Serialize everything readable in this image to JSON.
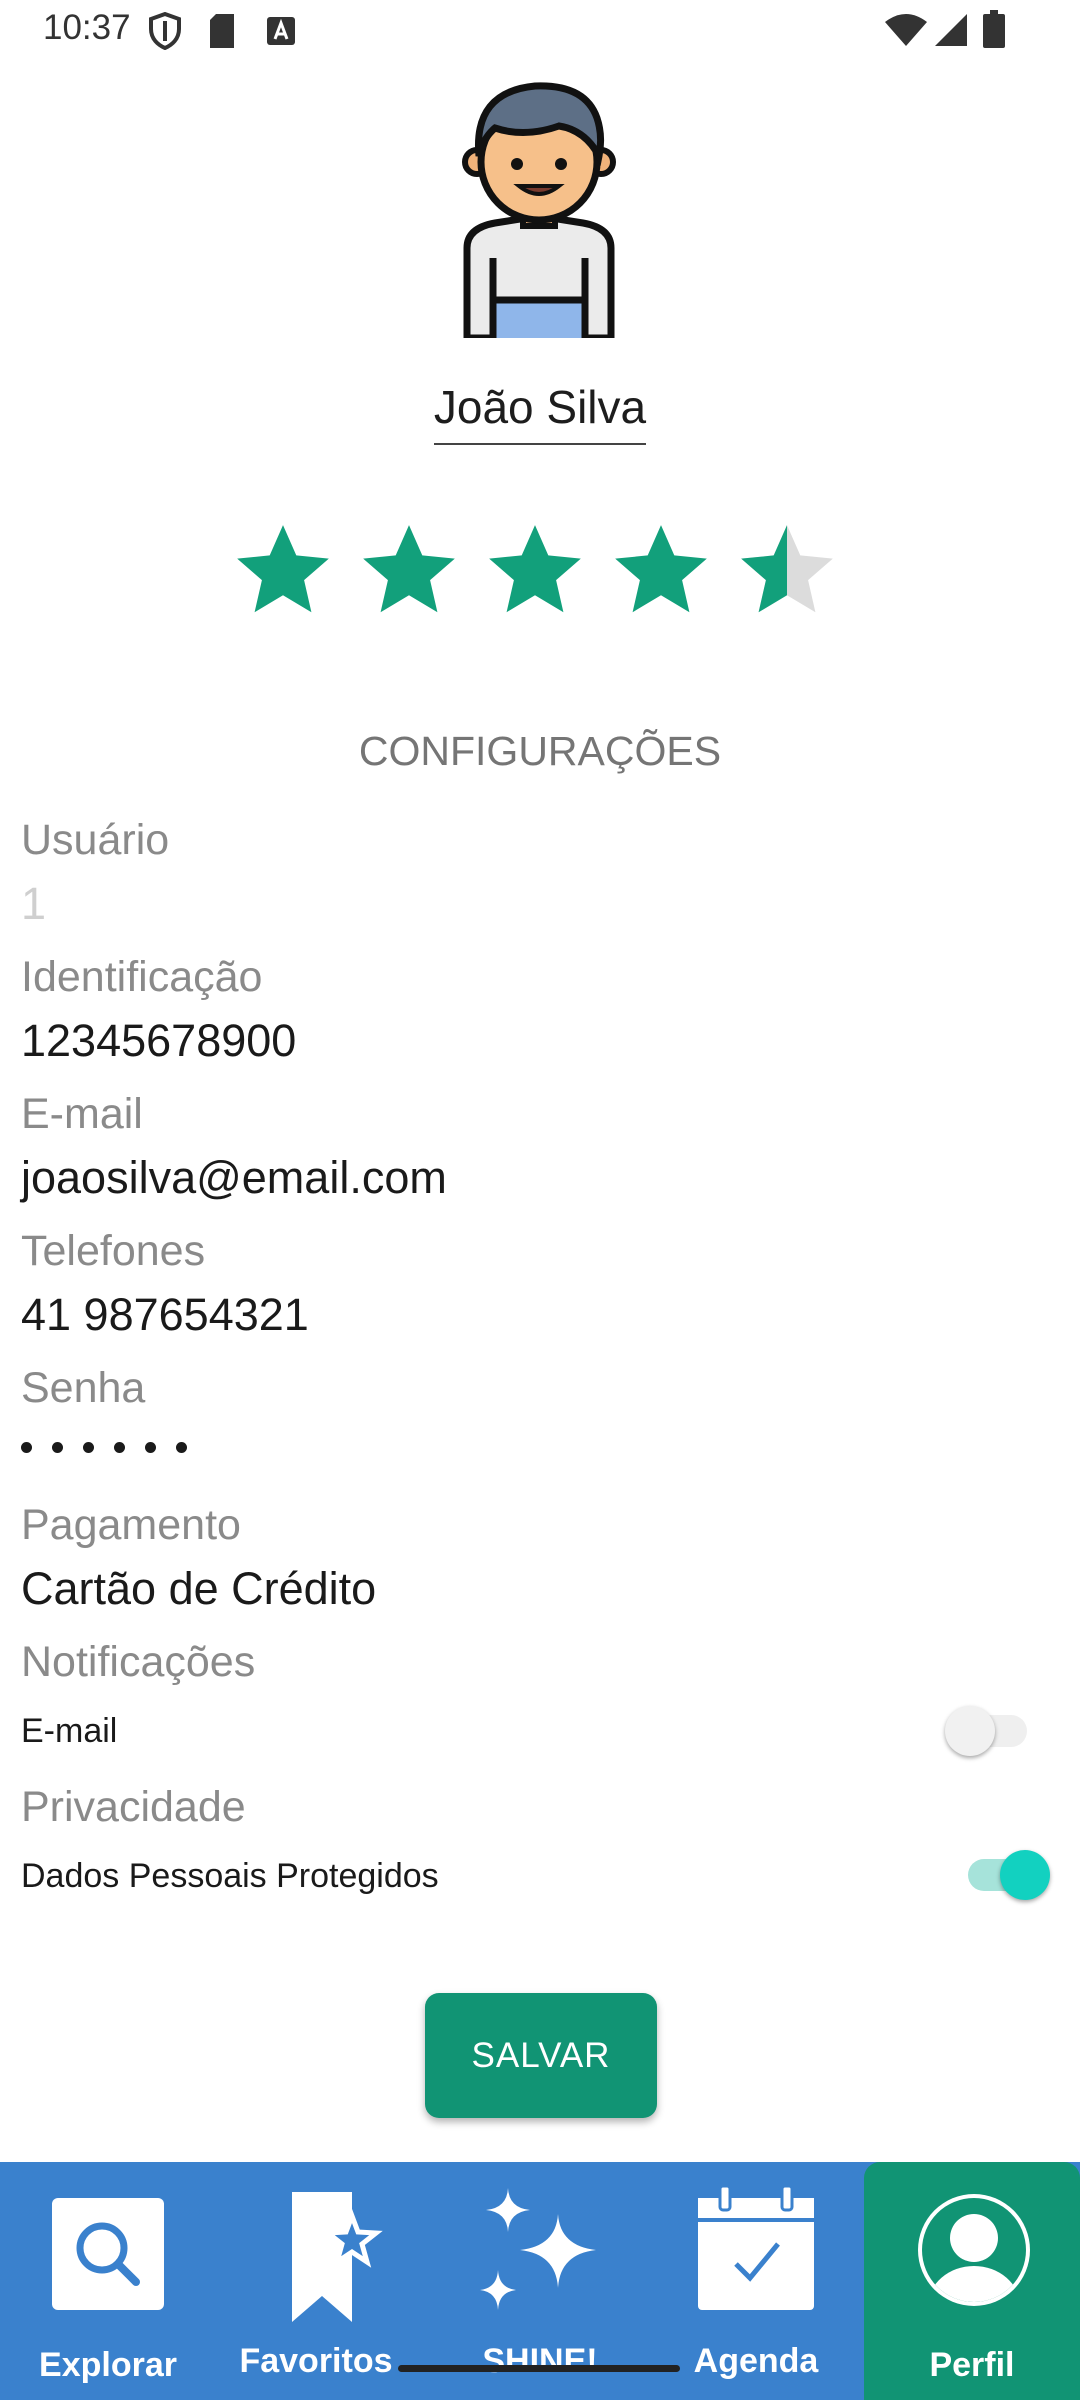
{
  "status_bar": {
    "time": "10:37",
    "left_icons": [
      "shield-icon",
      "sd-card-icon",
      "text-badge-icon"
    ],
    "right_icons": [
      "wifi-icon",
      "signal-icon",
      "battery-icon"
    ]
  },
  "profile": {
    "name": "João Silva",
    "rating": 4.5,
    "rating_max": 5
  },
  "settings": {
    "title": "CONFIGURAÇÕES",
    "user": {
      "label": "Usuário",
      "value": "1"
    },
    "id": {
      "label": "Identificação",
      "value": "12345678900"
    },
    "email": {
      "label": "E-mail",
      "value": "joaosilva@email.com"
    },
    "phones": {
      "label": "Telefones",
      "value": "41 987654321"
    },
    "password": {
      "label": "Senha",
      "masked_length": 6
    },
    "payment": {
      "label": "Pagamento",
      "value": "Cartão de Crédito"
    },
    "notifications": {
      "label": "Notificações",
      "option": "E-mail",
      "enabled": false
    },
    "privacy": {
      "label": "Privacidade",
      "option": "Dados Pessoais Protegidos",
      "enabled": true
    }
  },
  "save_label": "SALVAR",
  "nav": {
    "items": [
      {
        "label": "Explorar",
        "icon": "search-icon"
      },
      {
        "label": "Favoritos",
        "icon": "bookmark-star-icon"
      },
      {
        "label": "SHINE!",
        "icon": "sparkles-icon"
      },
      {
        "label": "Agenda",
        "icon": "calendar-check-icon"
      },
      {
        "label": "Perfil",
        "icon": "profile-icon",
        "active": true
      }
    ]
  },
  "colors": {
    "accent_green": "#119474",
    "star_green": "#12A07B",
    "nav_blue": "#3A81CD",
    "toggle_teal": "#12D1C0"
  }
}
